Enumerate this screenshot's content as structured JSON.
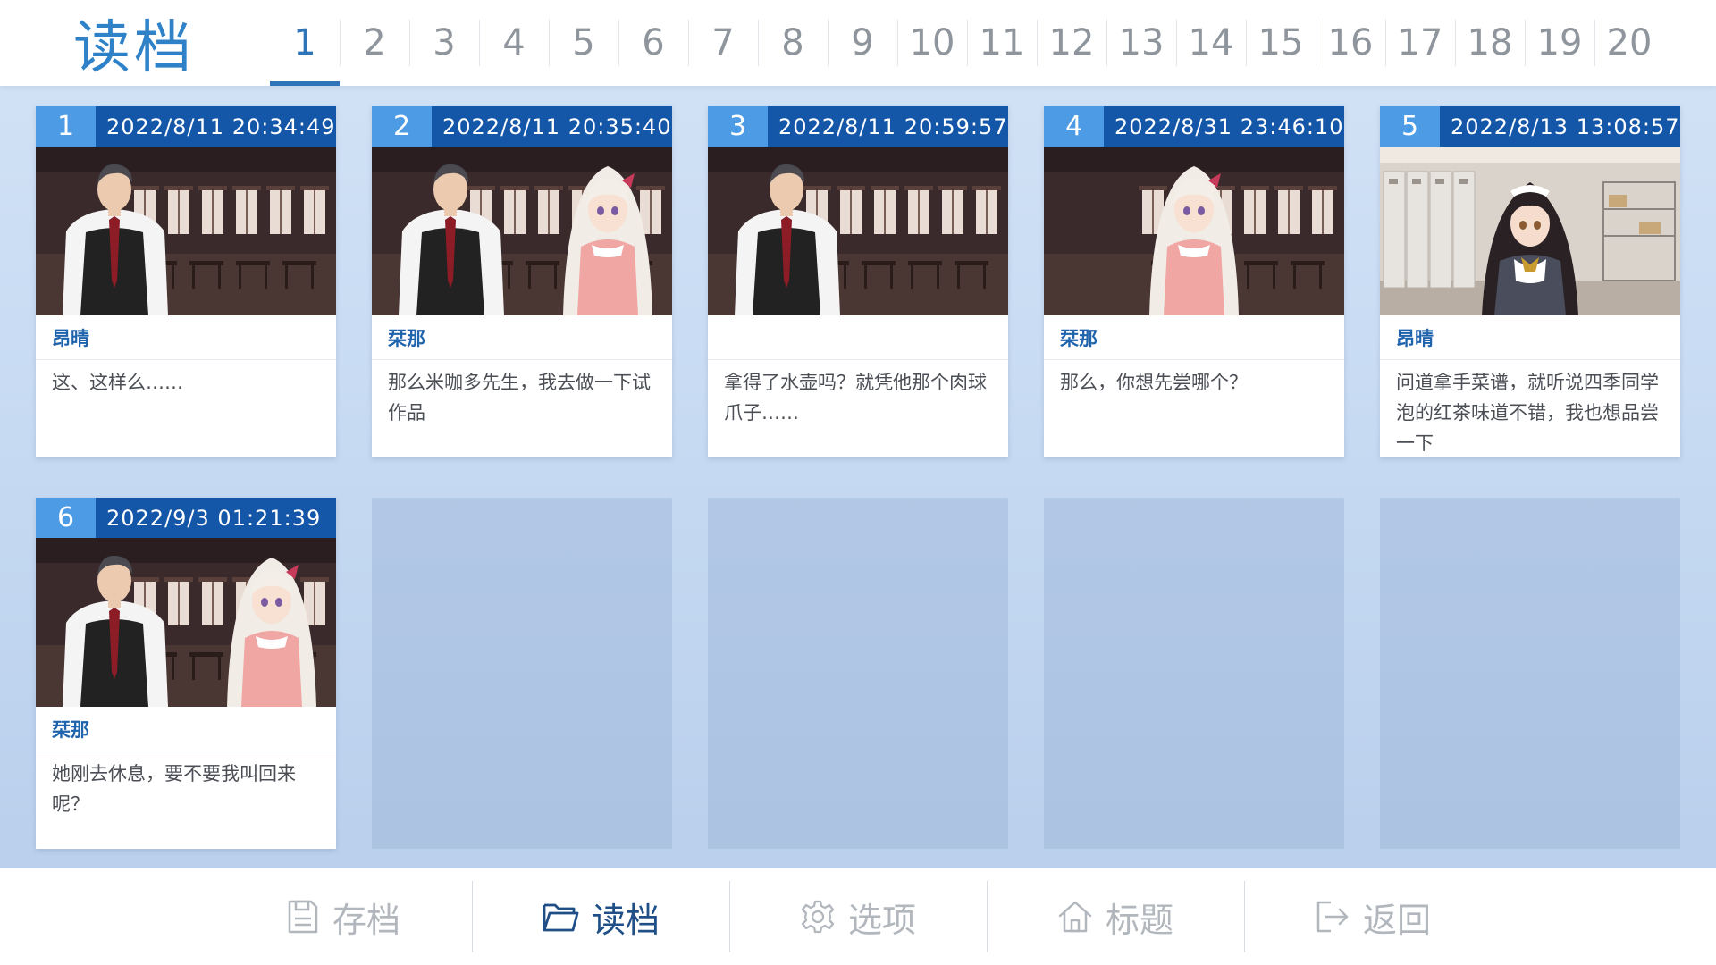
{
  "header": {
    "title": "读档",
    "tabs": [
      "1",
      "2",
      "3",
      "4",
      "5",
      "6",
      "7",
      "8",
      "9",
      "10",
      "11",
      "12",
      "13",
      "14",
      "15",
      "16",
      "17",
      "18",
      "19",
      "20"
    ],
    "active_tab": "1"
  },
  "slots": [
    {
      "number": "1",
      "datetime": "2022/8/11 20:34:49",
      "speaker": "昂晴",
      "text": "这、这样么……",
      "scene": "school-cafe",
      "characters": [
        "butler"
      ]
    },
    {
      "number": "2",
      "datetime": "2022/8/11 20:35:40",
      "speaker": "栞那",
      "text": "那么米咖多先生，我去做一下试作品",
      "scene": "school-cafe",
      "characters": [
        "butler",
        "pink-girl"
      ]
    },
    {
      "number": "3",
      "datetime": "2022/8/11 20:59:57",
      "speaker": "",
      "text": "拿得了水壶吗？就凭他那个肉球爪子……",
      "scene": "school-cafe",
      "characters": [
        "butler"
      ]
    },
    {
      "number": "4",
      "datetime": "2022/8/31 23:46:10",
      "speaker": "栞那",
      "text": "那么，你想先尝哪个？",
      "scene": "school-cafe",
      "characters": [
        "pink-girl-center"
      ]
    },
    {
      "number": "5",
      "datetime": "2022/8/13 13:08:57",
      "speaker": "昂晴",
      "text": "问道拿手菜谱，就听说四季同学泡的红茶味道不错，我也想品尝一下",
      "scene": "locker-room",
      "characters": [
        "maid-girl"
      ]
    },
    {
      "number": "6",
      "datetime": "2022/9/3 01:21:39",
      "speaker": "栞那",
      "text": "她刚去休息，要不要我叫回来呢？",
      "scene": "school-cafe",
      "characters": [
        "butler",
        "pink-girl"
      ]
    }
  ],
  "empty_slot_count": 4,
  "bottom_nav": [
    {
      "label": "存档",
      "icon": "save-icon"
    },
    {
      "label": "读档",
      "icon": "folder-icon",
      "active": true
    },
    {
      "label": "选项",
      "icon": "gear-icon"
    },
    {
      "label": "标题",
      "icon": "home-icon"
    },
    {
      "label": "返回",
      "icon": "exit-icon"
    }
  ],
  "colors": {
    "accent": "#2f74b8",
    "title": "#2f82c8",
    "slot_header": "#1457a8",
    "slot_number": "#4c9be4",
    "speaker": "#1f63ac",
    "nav_active": "#1f4f86",
    "nav_inactive": "#b2b7bd"
  }
}
